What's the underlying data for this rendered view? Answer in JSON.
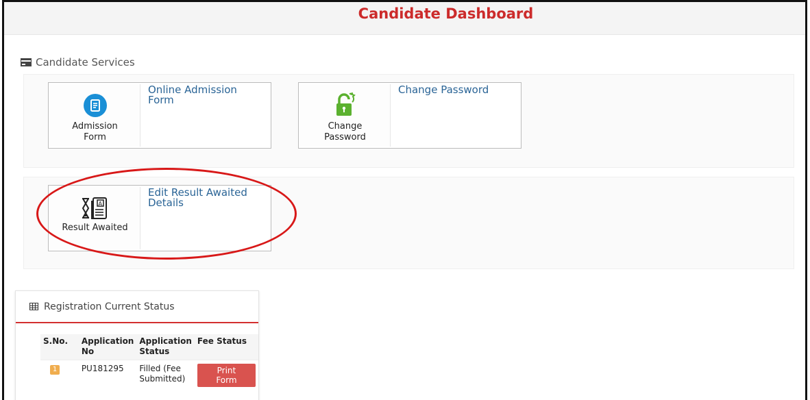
{
  "header": {
    "title": "Candidate Dashboard"
  },
  "services": {
    "heading": "Candidate Services",
    "tiles": [
      {
        "caption": "Admission Form",
        "link": "Online Admission Form",
        "icon": "document-icon"
      },
      {
        "caption": "Change Password",
        "link": "Change Password",
        "icon": "lock-icon"
      },
      {
        "caption": "Result Awaited",
        "link": "Edit Result Awaited Details",
        "icon": "hourglass-document-icon"
      }
    ]
  },
  "registration": {
    "heading": "Registration Current Status",
    "columns": [
      "S.No.",
      "Application No",
      "Application Status",
      "Fee Status"
    ],
    "rows": [
      {
        "sno": "1",
        "application_no": "PU181295",
        "application_status": "Filled (Fee Submitted)",
        "fee_action": "Print Form"
      }
    ]
  },
  "colors": {
    "title_red": "#cc2b2b",
    "link_blue": "#2a6496",
    "icon_blue": "#1a8fd6",
    "lock_green": "#5bb12f",
    "badge_orange": "#f0ad4e",
    "button_red": "#d9534f",
    "annotation_red": "#d81818"
  }
}
